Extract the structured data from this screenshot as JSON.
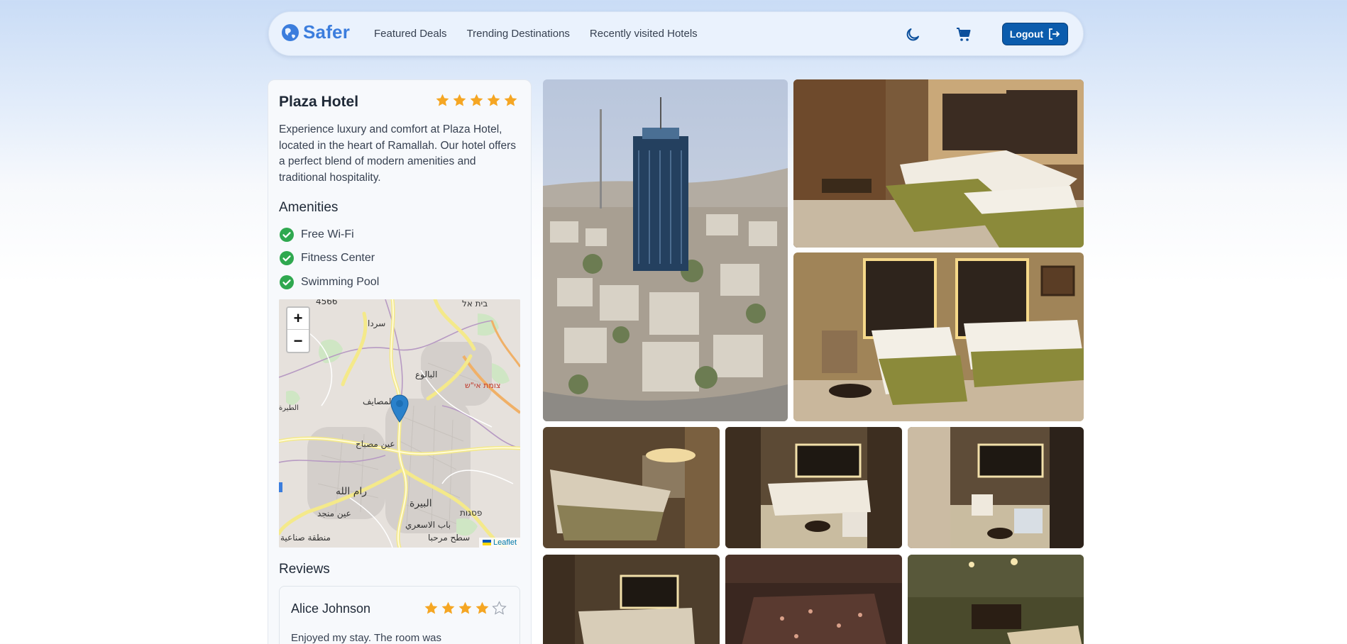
{
  "nav": {
    "brand": "Safer",
    "links": [
      "Featured Deals",
      "Trending Destinations",
      "Recently visited Hotels"
    ],
    "logout_label": "Logout",
    "icons": [
      "moon-icon",
      "cart-icon",
      "logout-icon"
    ]
  },
  "hotel": {
    "name": "Plaza Hotel",
    "rating": 5,
    "description": "Experience luxury and comfort at Plaza Hotel, located in the heart of Ramallah. Our hotel offers a perfect blend of modern amenities and traditional hospitality.",
    "amenities_title": "Amenities",
    "amenities": [
      "Free Wi-Fi",
      "Fitness Center",
      "Swimming Pool"
    ]
  },
  "map": {
    "zoom_in": "+",
    "zoom_out": "−",
    "attribution": "Leaflet",
    "labels": [
      "4566",
      "בית אל",
      "سردا",
      "البالوع",
      "צומת אי\"ש",
      "المصايف",
      "الطيرة",
      "عين مصباح",
      "رام الله",
      "البيرة",
      "عين منجد",
      "باب الاسعري",
      "منطقة صناعية",
      "سطح مرحبا",
      "פסגות"
    ]
  },
  "reviews": {
    "title": "Reviews",
    "items": [
      {
        "name": "Alice Johnson",
        "rating": 4,
        "text": "Enjoyed my stay. The room was"
      }
    ]
  },
  "colors": {
    "brand": "#3b7ddd",
    "button": "#0b5cad",
    "star": "#f5a623",
    "check": "#2fa84f"
  }
}
